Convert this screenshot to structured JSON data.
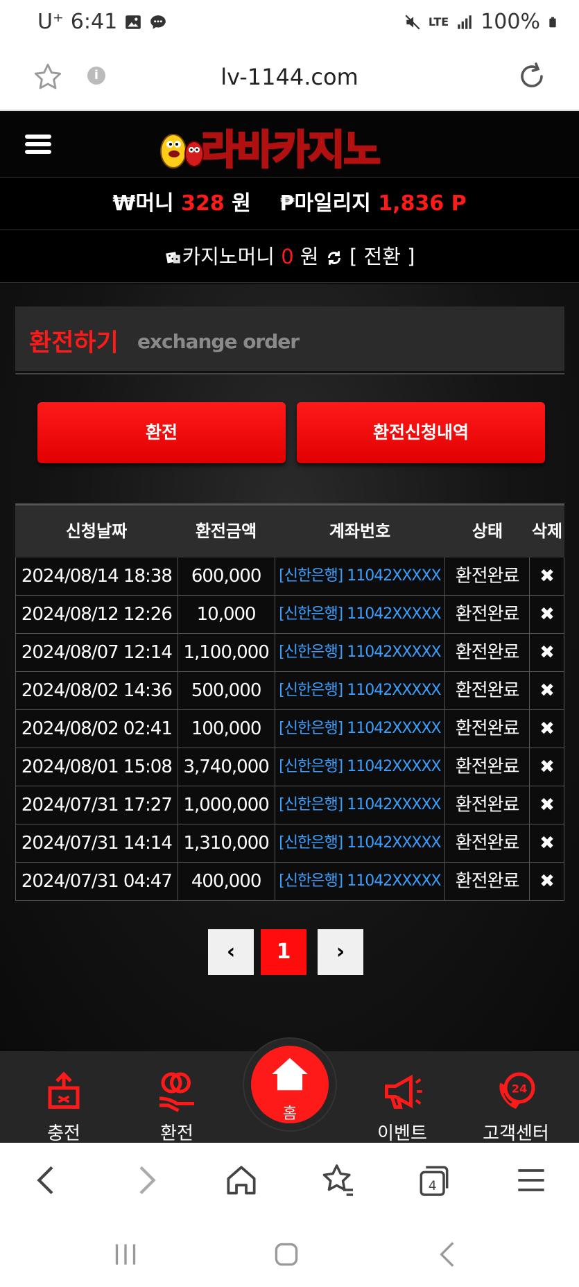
{
  "status_bar": {
    "carrier": "U⁺",
    "time": "6:41",
    "network": "LTE",
    "battery": "100%"
  },
  "browser": {
    "url": "lv-1144.com",
    "tab_count": "4"
  },
  "header": {
    "logo_text": "라바카지노"
  },
  "balance": {
    "money_label": "₩머니",
    "money_value": "328",
    "money_unit": "원",
    "mileage_label": "₱마일리지",
    "mileage_value": "1,836 P"
  },
  "casino": {
    "label": "카지노머니",
    "value": "0",
    "unit": "원",
    "switch_label": "[ 전환 ]"
  },
  "section": {
    "title_ko": "환전하기",
    "title_en": "exchange order"
  },
  "actions": {
    "exchange_label": "환전",
    "history_label": "환전신청내역"
  },
  "table": {
    "headers": [
      "신청날짜",
      "환전금액",
      "계좌번호",
      "상태",
      "삭제"
    ],
    "rows": [
      {
        "date": "2024/08/14 18:38",
        "amount": "600,000",
        "account": "[신한은행] 11042XXXXX",
        "status": "환전완료",
        "delete": "✖"
      },
      {
        "date": "2024/08/12 12:26",
        "amount": "10,000",
        "account": "[신한은행] 11042XXXXX",
        "status": "환전완료",
        "delete": "✖"
      },
      {
        "date": "2024/08/07 12:14",
        "amount": "1,100,000",
        "account": "[신한은행] 11042XXXXX",
        "status": "환전완료",
        "delete": "✖"
      },
      {
        "date": "2024/08/02 14:36",
        "amount": "500,000",
        "account": "[신한은행] 11042XXXXX",
        "status": "환전완료",
        "delete": "✖"
      },
      {
        "date": "2024/08/02 02:41",
        "amount": "100,000",
        "account": "[신한은행] 11042XXXXX",
        "status": "환전완료",
        "delete": "✖"
      },
      {
        "date": "2024/08/01 15:08",
        "amount": "3,740,000",
        "account": "[신한은행] 11042XXXXX",
        "status": "환전완료",
        "delete": "✖"
      },
      {
        "date": "2024/07/31 17:27",
        "amount": "1,000,000",
        "account": "[신한은행] 11042XXXXX",
        "status": "환전완료",
        "delete": "✖"
      },
      {
        "date": "2024/07/31 14:14",
        "amount": "1,310,000",
        "account": "[신한은행] 11042XXXXX",
        "status": "환전완료",
        "delete": "✖"
      },
      {
        "date": "2024/07/31 04:47",
        "amount": "400,000",
        "account": "[신한은행] 11042XXXXX",
        "status": "환전완료",
        "delete": "✖"
      }
    ]
  },
  "pagination": {
    "prev": "‹",
    "current": "1",
    "next": "›"
  },
  "bottom_nav": {
    "deposit": "충전",
    "withdraw": "환전",
    "home": "홈",
    "event": "이벤트",
    "support": "고객센터",
    "support_badge": "24"
  },
  "colors": {
    "accent": "#ff1a1a",
    "link": "#3aa0ff",
    "logo_yellow": "#ffcc1a"
  }
}
